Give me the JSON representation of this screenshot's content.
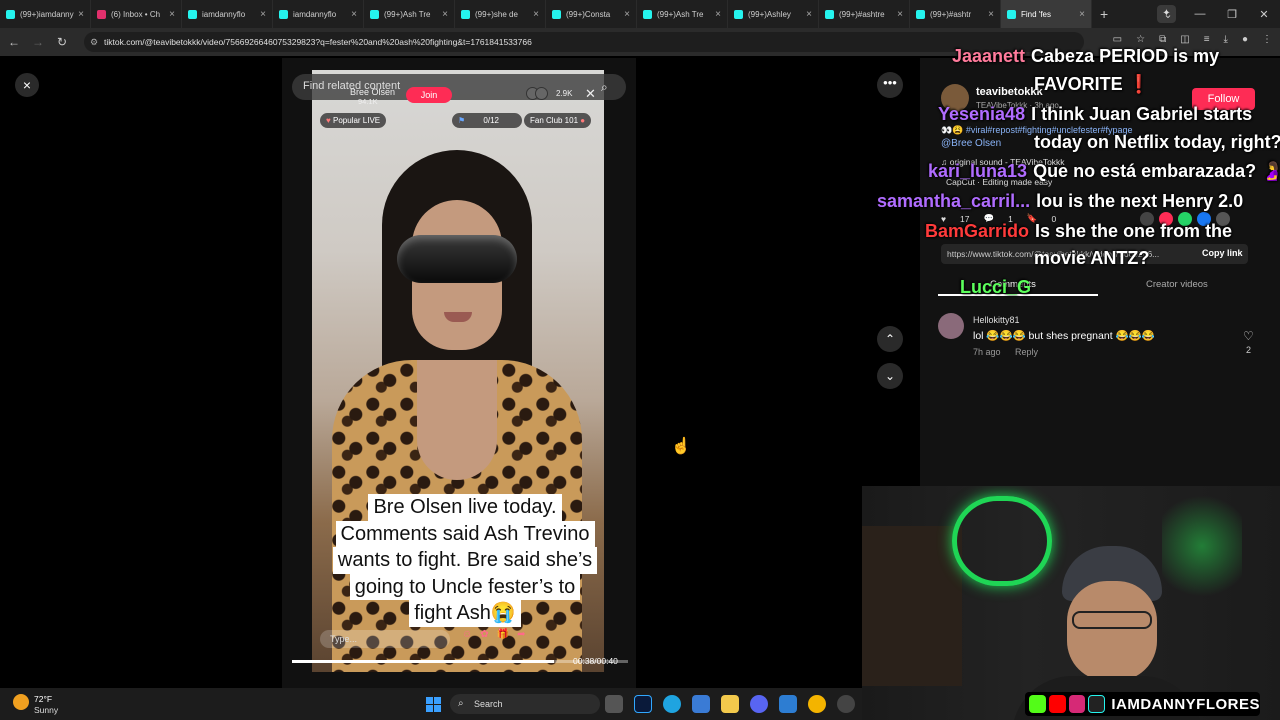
{
  "browser": {
    "tabs": [
      {
        "label": "(99+)iamdanny",
        "color": "#25f4ee"
      },
      {
        "label": "(6) Inbox • Ch",
        "color": "#e1306c"
      },
      {
        "label": "iamdannyflo",
        "color": "#25f4ee"
      },
      {
        "label": "iamdannyflo",
        "color": "#25f4ee"
      },
      {
        "label": "(99+)Ash Tre",
        "color": "#25f4ee"
      },
      {
        "label": "(99+)she de",
        "color": "#25f4ee"
      },
      {
        "label": "(99+)Consta",
        "color": "#25f4ee"
      },
      {
        "label": "(99+)Ash Tre",
        "color": "#25f4ee"
      },
      {
        "label": "(99+)Ashley",
        "color": "#25f4ee"
      },
      {
        "label": "(99+)#ashtre",
        "color": "#25f4ee"
      },
      {
        "label": "(99+)#ashtr",
        "color": "#25f4ee"
      },
      {
        "label": "Find 'fes",
        "color": "#25f4ee",
        "active": true
      }
    ],
    "new_tab": "+",
    "url": "tiktok.com/@teavibetokkk/video/7566926646075329823?q=fester%20and%20ash%20fighting&t=1761841533766"
  },
  "video": {
    "close_label": "×",
    "related_content": "Find related content",
    "live_host": "Bree Olsen",
    "live_viewers": "94.1K",
    "join_label": "Join",
    "viewer_count": "2.9K",
    "popular_live": "Popular LIVE",
    "goal": "0/12",
    "fan_club": "Fan Club 101",
    "caption_lines": [
      "Bre Olsen live today.",
      "Comments said Ash Trevino",
      "wants to fight. Bre said she’s",
      "going to Uncle fester’s to",
      "fight Ash😭"
    ],
    "type_placeholder": "Type...",
    "time": "00:38/00:40",
    "progress": 0.78
  },
  "panel": {
    "username": "teavibetokkk",
    "subtitle": "TEAVibeTokkk · 3h ago",
    "follow_label": "Follow",
    "hashtags": "👀😩 #viral#repost#fighting#unclefester#fypage",
    "mention": "@Bree Olsen",
    "sound": "♫ original sound - TEAVibeTokkk",
    "capcut": "CapCut · Editing made easy",
    "likes": "17",
    "comments": "1",
    "saves": "0",
    "share_link": "https://www.tiktok.com/@teavibetokkk/video/75669266...",
    "copy_link": "Copy link",
    "tab_comments": "Comments",
    "tab_creator": "Creator videos",
    "comment": {
      "user": "Hellokitty81",
      "text": "lol 😂😂😂 but shes pregnant 😂😂😂",
      "time": "7h ago",
      "reply": "Reply",
      "likes": "2"
    }
  },
  "chat": [
    {
      "name": "Jaaanett",
      "color": "#ff7b9c",
      "msg": "Cabeza PERIOD is my",
      "cont": "FAVORITE ❗"
    },
    {
      "name": "Yesenia48",
      "color": "#b06cff",
      "msg": "I think Juan Gabriel starts",
      "cont": "today on Netflix today, right?"
    },
    {
      "name": "kari_luna13",
      "color": "#b06cff",
      "msg": "Que no está embarazada? 🤰",
      "cont": ""
    },
    {
      "name": "samantha_carril...",
      "color": "#b06cff",
      "msg": "lou is the next Henry 2.0",
      "cont": ""
    },
    {
      "name": "BamGarrido",
      "color": "#ff3b3b",
      "msg": "Is she the one from the",
      "cont": "movie ANTZ?"
    },
    {
      "name": "Lucci_G",
      "color": "#5cff5c",
      "msg": "",
      "cont": ""
    }
  ],
  "stream": {
    "handle": "IAMDANNYFLORES"
  },
  "taskbar": {
    "temp": "72°F",
    "condition": "Sunny",
    "search": "Search"
  },
  "colors": {
    "tiktok_red": "#fe2c55",
    "link_blue": "#8ab4f8",
    "neon_green": "#1fd655"
  }
}
